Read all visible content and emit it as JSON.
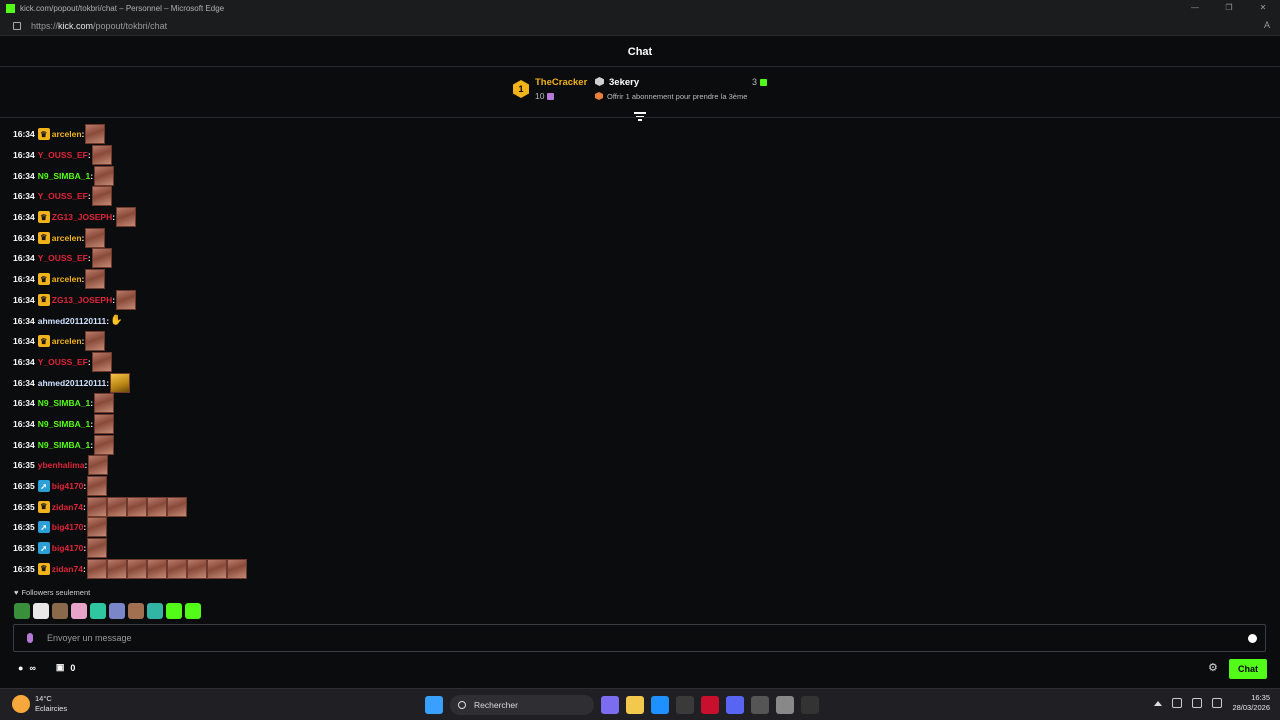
{
  "browser": {
    "title": "kick.com/popout/tokbri/chat – Personnel – Microsoft Edge",
    "url_prefix": "https://",
    "url_host": "kick.com",
    "url_path": "/popout/tokbri/chat",
    "read_aloud": "A̅"
  },
  "chat": {
    "header": "Chat",
    "leaderboard": {
      "rank": "1",
      "first_name": "TheCracker",
      "first_count": "10",
      "second_name": "3ekery",
      "second_count": "3",
      "offer": "Offrir 1 abonnement pour prendre la 3ème"
    },
    "messages": [
      {
        "time": "16:34",
        "badge": "crown",
        "user": "arcelen",
        "color": "#f2b31a",
        "emotes": 1
      },
      {
        "time": "16:34",
        "badge": "",
        "user": "Y_OUSS_EF",
        "color": "#e0243a",
        "emotes": 1
      },
      {
        "time": "16:34",
        "badge": "",
        "user": "N9_SIMBA_1",
        "color": "#53fc18",
        "emotes": 1
      },
      {
        "time": "16:34",
        "badge": "",
        "user": "Y_OUSS_EF",
        "color": "#e0243a",
        "emotes": 1
      },
      {
        "time": "16:34",
        "badge": "crown",
        "user": "ZG13_JOSEPH",
        "color": "#e0243a",
        "emotes": 1
      },
      {
        "time": "16:34",
        "badge": "crown",
        "user": "arcelen",
        "color": "#f2b31a",
        "emotes": 1
      },
      {
        "time": "16:34",
        "badge": "",
        "user": "Y_OUSS_EF",
        "color": "#e0243a",
        "emotes": 1
      },
      {
        "time": "16:34",
        "badge": "crown",
        "user": "arcelen",
        "color": "#f2b31a",
        "emotes": 1
      },
      {
        "time": "16:34",
        "badge": "crown",
        "user": "ZG13_JOSEPH",
        "color": "#e0243a",
        "emotes": 1
      },
      {
        "time": "16:34",
        "badge": "",
        "user": "ahmed201120111",
        "color": "#cfe3ff",
        "emotes": 1,
        "emote_kind": "small"
      },
      {
        "time": "16:34",
        "badge": "crown",
        "user": "arcelen",
        "color": "#f2b31a",
        "emotes": 1
      },
      {
        "time": "16:34",
        "badge": "",
        "user": "Y_OUSS_EF",
        "color": "#e0243a",
        "emotes": 1
      },
      {
        "time": "16:34",
        "badge": "",
        "user": "ahmed201120111",
        "color": "#cfe3ff",
        "emotes": 1,
        "emote_kind": "gold"
      },
      {
        "time": "16:34",
        "badge": "",
        "user": "N9_SIMBA_1",
        "color": "#53fc18",
        "emotes": 1
      },
      {
        "time": "16:34",
        "badge": "",
        "user": "N9_SIMBA_1",
        "color": "#53fc18",
        "emotes": 1
      },
      {
        "time": "16:34",
        "badge": "",
        "user": "N9_SIMBA_1",
        "color": "#53fc18",
        "emotes": 1
      },
      {
        "time": "16:35",
        "badge": "",
        "user": "ybenhalima",
        "color": "#e0243a",
        "emotes": 1
      },
      {
        "time": "16:35",
        "badge": "plane",
        "user": "big4170",
        "color": "#e0243a",
        "emotes": 1
      },
      {
        "time": "16:35",
        "badge": "crown",
        "user": "zidan74",
        "color": "#e0243a",
        "emotes": 5
      },
      {
        "time": "16:35",
        "badge": "plane",
        "user": "big4170",
        "color": "#e0243a",
        "emotes": 1
      },
      {
        "time": "16:35",
        "badge": "plane",
        "user": "big4170",
        "color": "#e0243a",
        "emotes": 1
      },
      {
        "time": "16:35",
        "badge": "crown",
        "user": "zidan74",
        "color": "#e0243a",
        "emotes": 8
      }
    ],
    "followers_only": "Followers seulement",
    "emote_bar_colors": [
      "#3a8f3a",
      "#e8e8e8",
      "#8a6a4a",
      "#e7a3c8",
      "#2ec7a0",
      "#7b86c8",
      "#a07050",
      "#33b5a5",
      "#53fc18",
      "#53fc18"
    ],
    "input_placeholder": "Envoyer un message",
    "infinity": "∞",
    "points": "0",
    "chat_button": "Chat"
  },
  "taskbar": {
    "temp": "14°C",
    "weather": "Eclaircies",
    "search": "Rechercher",
    "time": "16:35",
    "date": "28/03/2026",
    "app_colors": [
      "#7b6cf0",
      "#f2c94c",
      "#1e90ff",
      "#3a3a3a",
      "#c8102e",
      "#5865f2",
      "#555",
      "#888",
      "#333"
    ]
  }
}
